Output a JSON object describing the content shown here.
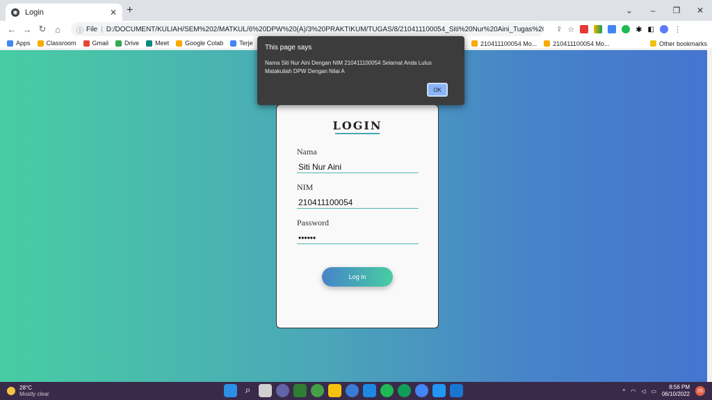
{
  "browser": {
    "tab_title": "Login",
    "url_prefix": "File",
    "url": "D:/DOCUMENT/KULIAH/SEM%202/MATKUL/6%20DPW%20(A)/3%20PRAKTIKUM/TUGAS/8/210411100054_Siti%20Nur%20Aini_Tugas%20Praktikum%208_DP...",
    "bookmarks": [
      {
        "label": "Apps",
        "color": "#4285f4"
      },
      {
        "label": "Classroom",
        "color": "#f9ab00"
      },
      {
        "label": "Gmail",
        "color": "#ea4335"
      },
      {
        "label": "Drive",
        "color": "#34a853"
      },
      {
        "label": "Meet",
        "color": "#00897b"
      },
      {
        "label": "Google Colab",
        "color": "#f9ab00"
      },
      {
        "label": "Terje",
        "color": "#4285f4"
      }
    ],
    "bookmarks_right": [
      {
        "label": "210411100054 Mo...",
        "color": "#f9ab00"
      },
      {
        "label": "210411100054 Mo...",
        "color": "#f9ab00"
      }
    ],
    "other_bookmarks": "Other bookmarks"
  },
  "login": {
    "title": "LOGIN",
    "nama_label": "Nama",
    "nama_value": "Siti Nur Aini",
    "nim_label": "NIM",
    "nim_value": "210411100054",
    "password_label": "Password",
    "password_value": "••••••",
    "button_label": "Log in"
  },
  "dialog": {
    "title": "This page says",
    "message": "Nama Siti Nur Aini Dengan NIM 210411100054 Selamat Anda Lulus Matakuliah DPW Dengan Nilai A",
    "ok_label": "OK"
  },
  "taskbar": {
    "temperature": "28°C",
    "weather": "Mostly clear",
    "time": "8:56 PM",
    "date": "06/10/2022",
    "notification_count": "25"
  }
}
